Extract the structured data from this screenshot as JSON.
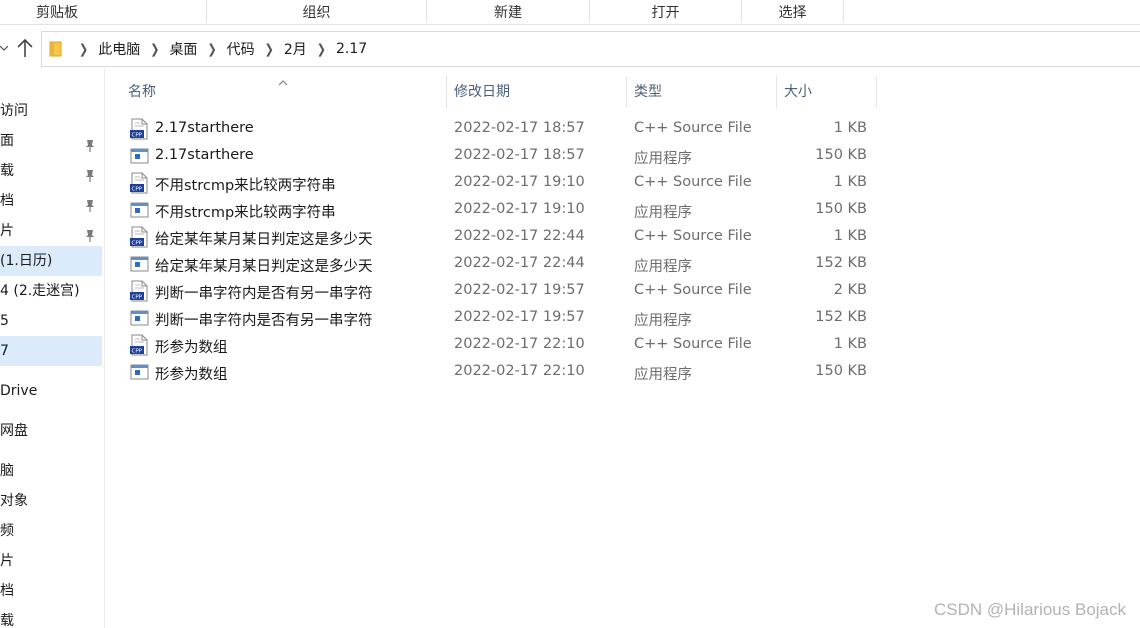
{
  "ribbon": {
    "groups": [
      "剪贴板",
      "组织",
      "新建",
      "打开",
      "选择"
    ]
  },
  "address": {
    "crumbs": [
      "此电脑",
      "桌面",
      "代码",
      "2月",
      "2.17"
    ]
  },
  "nav_pane": {
    "items": [
      {
        "label": "访问",
        "selected": false,
        "pinned": false
      },
      {
        "label": "面",
        "selected": false,
        "pinned": true
      },
      {
        "label": "载",
        "selected": false,
        "pinned": true
      },
      {
        "label": "档",
        "selected": false,
        "pinned": true
      },
      {
        "label": "片",
        "selected": false,
        "pinned": true
      },
      {
        "label": " (1.日历)",
        "selected": true,
        "pinned": false
      },
      {
        "label": "4  (2.走迷宫)",
        "selected": false,
        "pinned": false
      },
      {
        "label": "5",
        "selected": false,
        "pinned": false
      },
      {
        "label": "7",
        "selected": true,
        "pinned": false
      },
      {
        "label": "Drive",
        "selected": false,
        "pinned": false
      },
      {
        "label": "网盘",
        "selected": false,
        "pinned": false
      },
      {
        "label": "脑",
        "selected": false,
        "pinned": false
      },
      {
        "label": "对象",
        "selected": false,
        "pinned": false
      },
      {
        "label": "频",
        "selected": false,
        "pinned": false
      },
      {
        "label": "片",
        "selected": false,
        "pinned": false
      },
      {
        "label": "档",
        "selected": false,
        "pinned": false
      },
      {
        "label": "载",
        "selected": false,
        "pinned": false
      }
    ]
  },
  "columns": {
    "name": "名称",
    "date": "修改日期",
    "type": "类型",
    "size": "大小"
  },
  "files": [
    {
      "name": "2.17starthere",
      "date": "2022-02-17 18:57",
      "type": "C++ Source File",
      "size": "1 KB",
      "icon": "cpp-file-icon"
    },
    {
      "name": "2.17starthere",
      "date": "2022-02-17 18:57",
      "type": "应用程序",
      "size": "150 KB",
      "icon": "exe-file-icon"
    },
    {
      "name": "不用strcmp来比较两字符串",
      "date": "2022-02-17 19:10",
      "type": "C++ Source File",
      "size": "1 KB",
      "icon": "cpp-file-icon"
    },
    {
      "name": "不用strcmp来比较两字符串",
      "date": "2022-02-17 19:10",
      "type": "应用程序",
      "size": "150 KB",
      "icon": "exe-file-icon"
    },
    {
      "name": "给定某年某月某日判定这是多少天",
      "date": "2022-02-17 22:44",
      "type": "C++ Source File",
      "size": "1 KB",
      "icon": "cpp-file-icon"
    },
    {
      "name": "给定某年某月某日判定这是多少天",
      "date": "2022-02-17 22:44",
      "type": "应用程序",
      "size": "152 KB",
      "icon": "exe-file-icon"
    },
    {
      "name": "判断一串字符内是否有另一串字符",
      "date": "2022-02-17 19:57",
      "type": "C++ Source File",
      "size": "2 KB",
      "icon": "cpp-file-icon"
    },
    {
      "name": "判断一串字符内是否有另一串字符",
      "date": "2022-02-17 19:57",
      "type": "应用程序",
      "size": "152 KB",
      "icon": "exe-file-icon"
    },
    {
      "name": "形参为数组",
      "date": "2022-02-17 22:10",
      "type": "C++ Source File",
      "size": "1 KB",
      "icon": "cpp-file-icon"
    },
    {
      "name": "形参为数组",
      "date": "2022-02-17 22:10",
      "type": "应用程序",
      "size": "150 KB",
      "icon": "exe-file-icon"
    }
  ],
  "watermark": "CSDN @Hilarious Bojack",
  "colors": {
    "selection": "#dcebfc",
    "header_text": "#4c607a",
    "secondary_text": "#6d6d6d",
    "cpp_badge": "#1f3f9a"
  }
}
